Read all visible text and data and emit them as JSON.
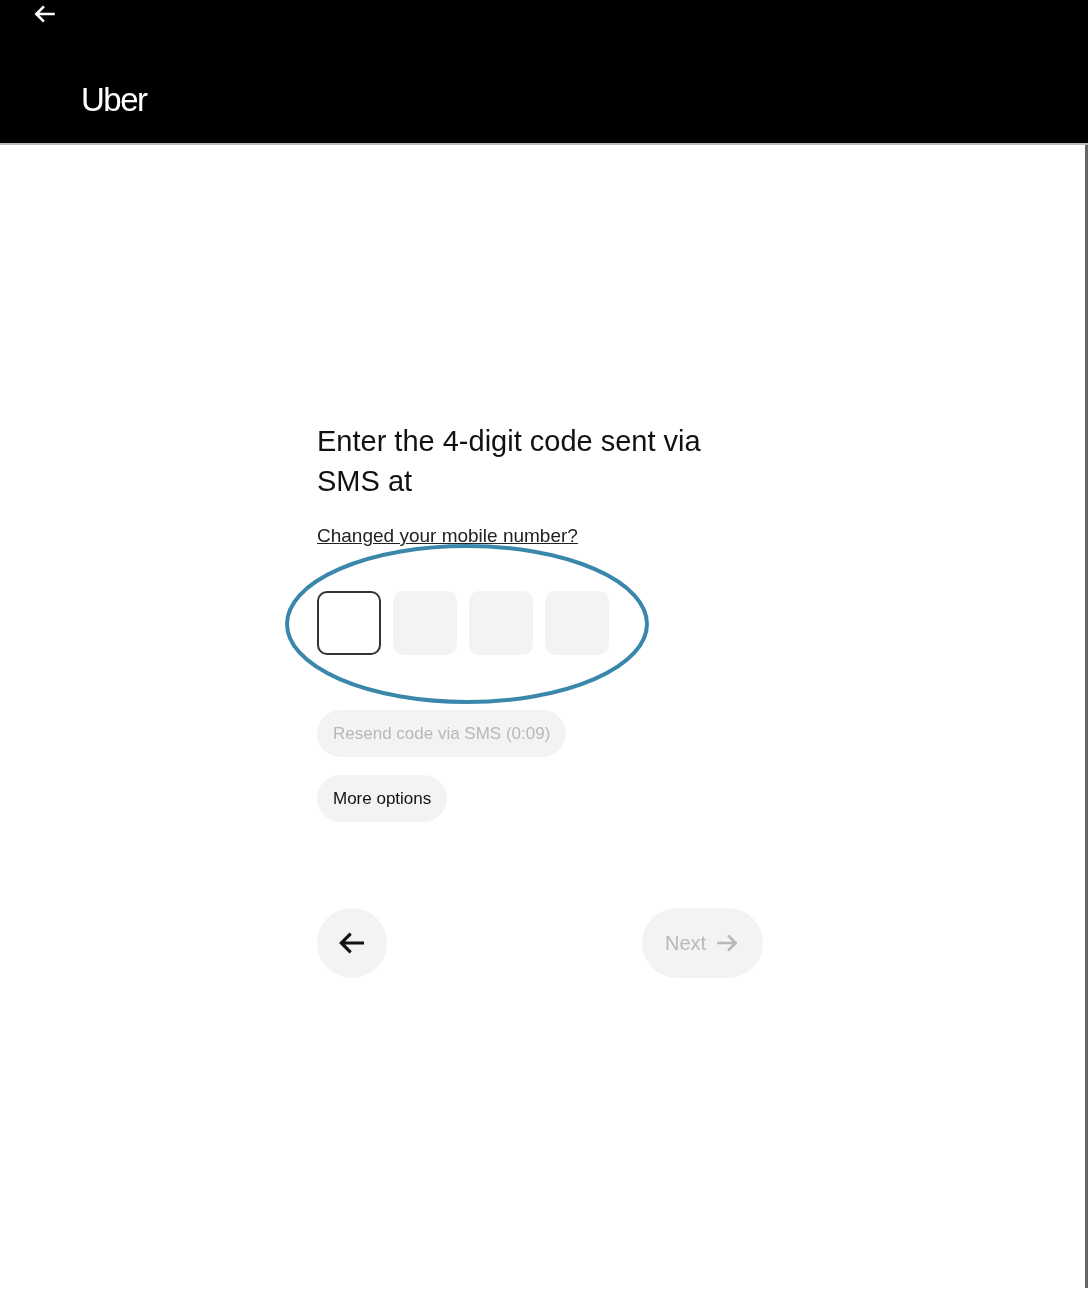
{
  "header": {
    "logo": "Uber"
  },
  "title": "Enter the 4-digit code sent via SMS at",
  "change_number_link": "Changed your mobile number?",
  "code_boxes": [
    {
      "focused": true
    },
    {
      "focused": false
    },
    {
      "focused": false
    },
    {
      "focused": false
    }
  ],
  "buttons": [
    {
      "label": "Resend code via SMS (0:09)",
      "disabled": true
    },
    {
      "label": "More options",
      "disabled": false
    }
  ],
  "next_button": {
    "label": "Next",
    "disabled": true
  }
}
